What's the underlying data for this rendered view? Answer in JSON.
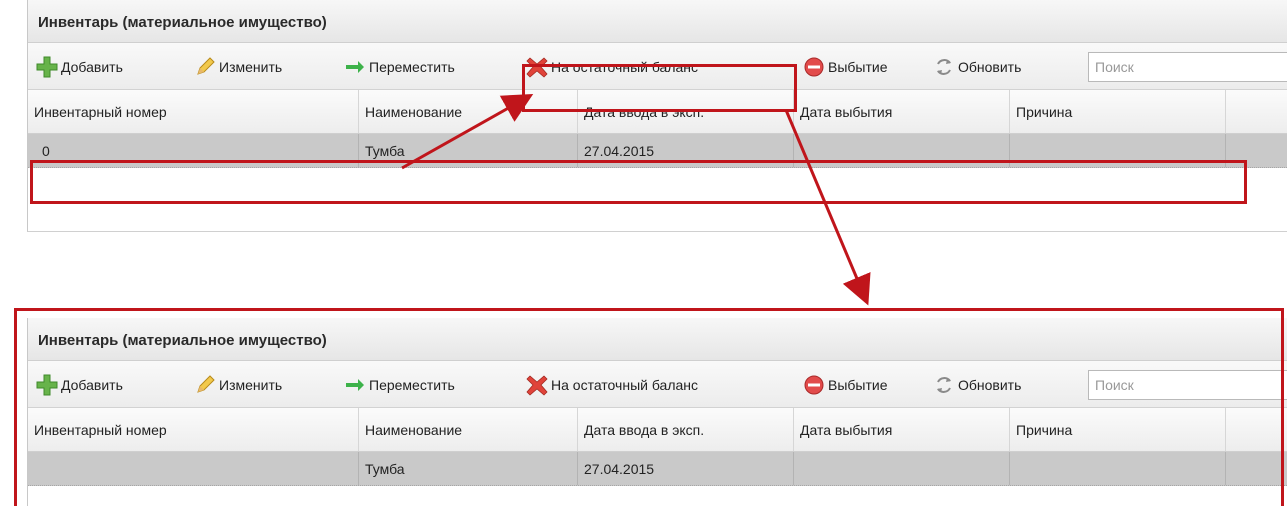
{
  "window_title": "Инвентарь (материальное имущество)",
  "toolbar": {
    "add": "Добавить",
    "edit": "Изменить",
    "move": "Переместить",
    "residual": "На остаточный баланс",
    "disposal": "Выбытие",
    "refresh": "Обновить",
    "search_placeholder": "Поиск"
  },
  "columns": [
    "Инвентарный номер",
    "Наименование",
    "Дата ввода в эксп.",
    "Дата выбытия",
    "Причина"
  ],
  "before": {
    "row": {
      "number": "0",
      "name": "Тумба",
      "date_in": "27.04.2015",
      "date_out": "",
      "reason": ""
    }
  },
  "after": {
    "row": {
      "number": "",
      "name": "Тумба",
      "date_in": "27.04.2015",
      "date_out": "",
      "reason": ""
    }
  },
  "colors": {
    "highlight": "#c0151b",
    "row_selected": "#c9c9c9"
  },
  "icons": [
    "add-icon",
    "edit-icon",
    "move-icon",
    "residual-icon",
    "disposal-icon",
    "refresh-icon",
    "arrow-icon"
  ]
}
